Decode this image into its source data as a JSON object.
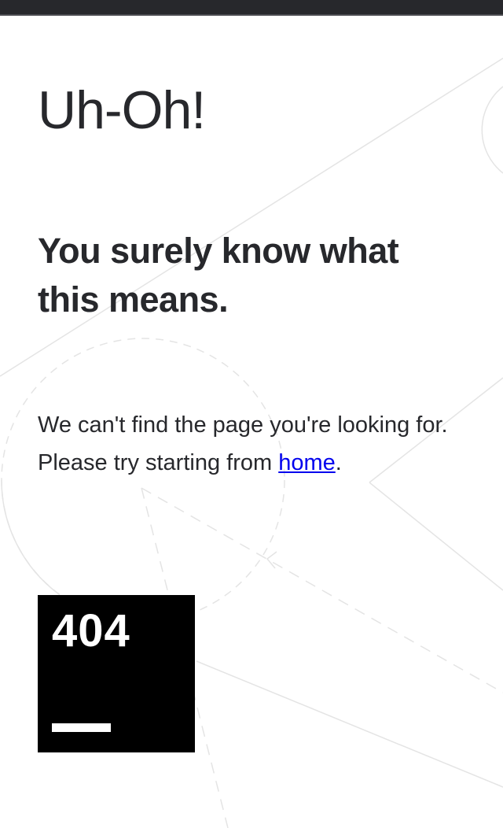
{
  "page": {
    "title": "Uh-Oh!",
    "subtitle": "You surely know what this means.",
    "message_before_link": "We can't find the page you're looking for. Please try starting from ",
    "link_label": "home",
    "message_after_link": "."
  },
  "badge": {
    "code": "404",
    "background": "#000000",
    "foreground": "#ffffff"
  },
  "colors": {
    "top_bar": "#27282c",
    "text": "#27282c",
    "link": "#0000ee",
    "decor_lines": "#e4e4e4"
  }
}
